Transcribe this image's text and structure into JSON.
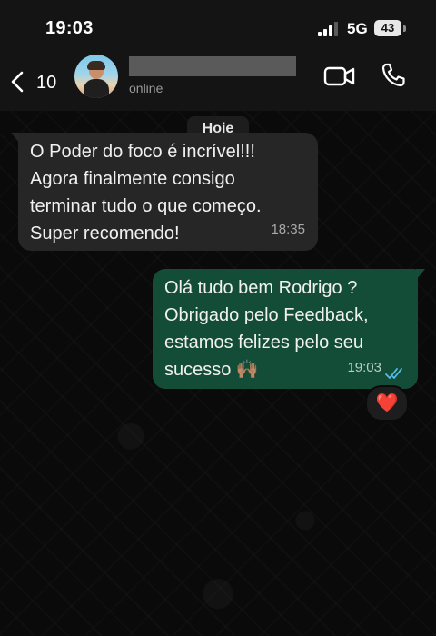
{
  "status_bar": {
    "time": "19:03",
    "network": "5G",
    "battery": "43"
  },
  "header": {
    "back_count": "10",
    "contact_status": "online",
    "icons": {
      "back": "chevron-left-icon",
      "video": "video-camera-icon",
      "voice": "phone-icon"
    }
  },
  "chat": {
    "date_label": "Hoje",
    "messages": [
      {
        "direction": "incoming",
        "text": "O Poder do foco é incrível!!!\nAgora finalmente consigo\nterminar tudo o que começo.\nSuper recomendo!",
        "time": "18:35"
      },
      {
        "direction": "outgoing",
        "text": "Olá tudo bem Rodrigo ?\nObrigado pelo Feedback,\nestamos felizes pelo seu\nsucesso 🙌🏽",
        "time": "19:03",
        "status": "read",
        "reaction": "❤️"
      }
    ]
  },
  "colors": {
    "incoming_bubble": "#262626",
    "outgoing_bubble": "#144d37",
    "read_receipt": "#53bdeb",
    "background": "#0a0a0a"
  }
}
